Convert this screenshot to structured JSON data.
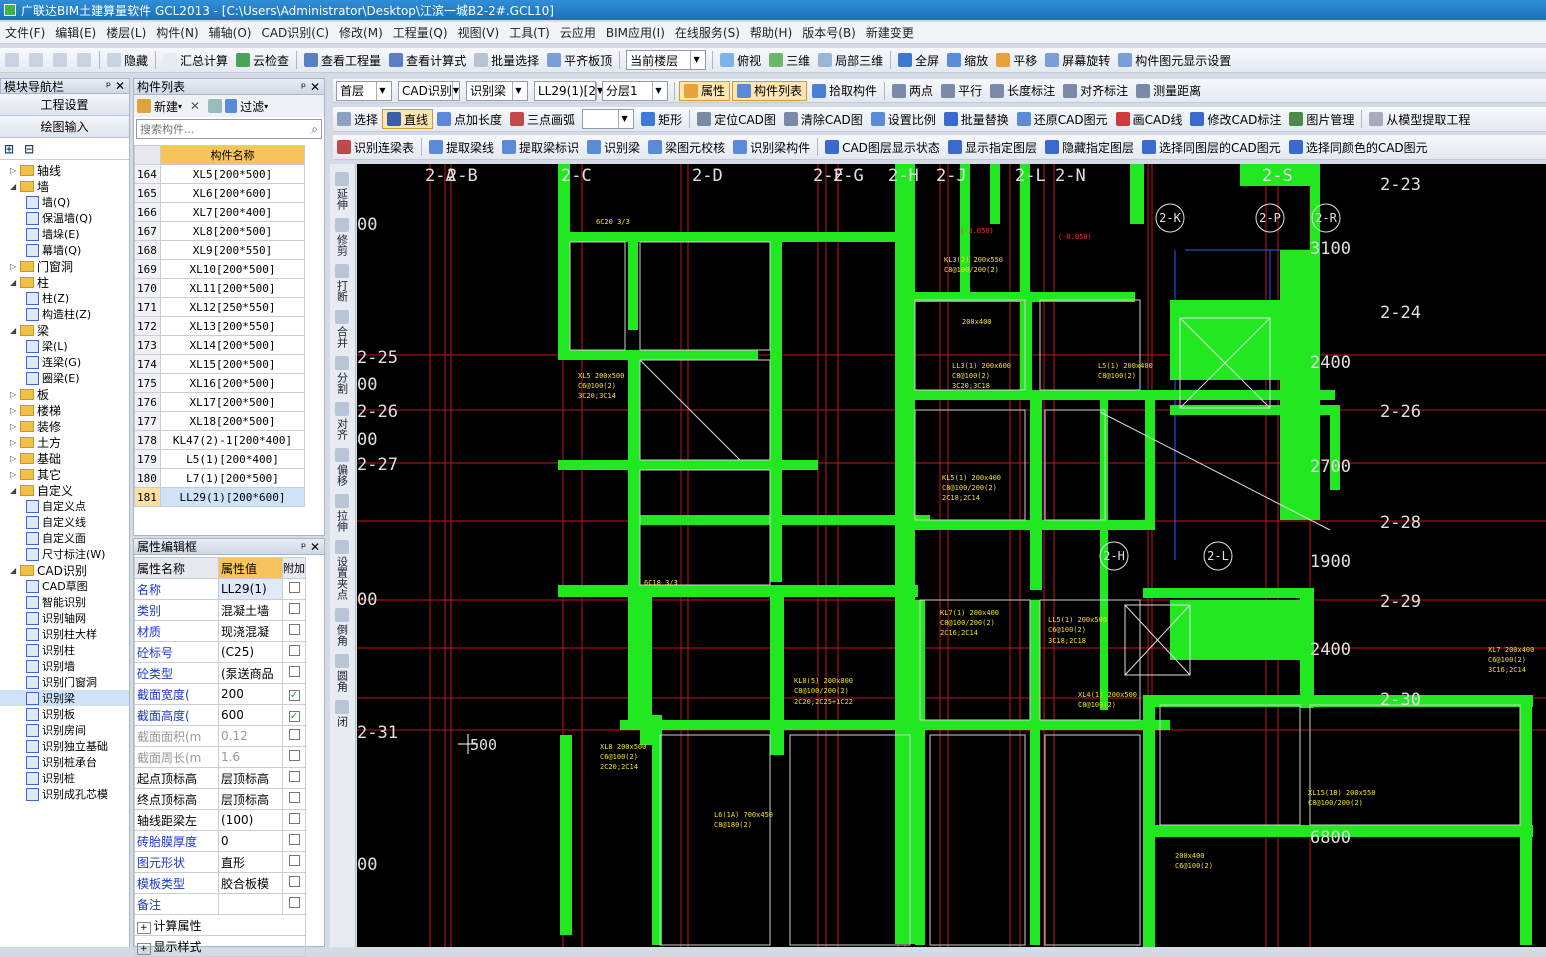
{
  "window": {
    "title": "广联达BIM土建算量软件 GCL2013 - [C:\\Users\\Administrator\\Desktop\\江滨一城B2-2#.GCL10]"
  },
  "menu": [
    "文件(F)",
    "编辑(E)",
    "楼层(L)",
    "构件(N)",
    "辅轴(O)",
    "CAD识别(C)",
    "修改(M)",
    "工程量(Q)",
    "视图(V)",
    "工具(T)",
    "云应用",
    "BIM应用(I)",
    "在线服务(S)",
    "帮助(H)",
    "版本号(B)",
    "新建变更"
  ],
  "toolbar1": {
    "items": [
      "隐藏",
      "汇总计算",
      "云检查",
      "查看工程量",
      "查看计算式",
      "批量选择",
      "平齐板顶"
    ],
    "floor_combo": "当前楼层",
    "view_items": [
      "俯视",
      "三维",
      "局部三维",
      "全屏",
      "缩放",
      "平移",
      "屏幕旋转",
      "构件图元显示设置"
    ]
  },
  "toolbar2": {
    "floor": "首层",
    "cad": "CAD识别",
    "type": "识别梁",
    "comp": "LL29(1)[2",
    "layer": "分层1",
    "items": [
      "属性",
      "构件列表",
      "拾取构件",
      "两点",
      "平行",
      "长度标注",
      "对齐标注",
      "测量距离"
    ]
  },
  "toolbar3": {
    "items": [
      "选择",
      "直线",
      "点加长度",
      "三点画弧",
      "矩形",
      "定位CAD图",
      "清除CAD图",
      "设置比例",
      "批量替换",
      "还原CAD图元",
      "画CAD线",
      "修改CAD标注",
      "图片管理",
      "从模型提取工程"
    ]
  },
  "toolbar4": {
    "items": [
      "识别连梁表",
      "提取梁线",
      "提取梁标识",
      "识别梁",
      "梁图元校核",
      "识别梁构件",
      "CAD图层显示状态",
      "显示指定图层",
      "隐藏指定图层",
      "选择同图层的CAD图元",
      "选择同颜色的CAD图元"
    ]
  },
  "nav": {
    "title": "模块导航栏",
    "btn1": "工程设置",
    "btn2": "绘图输入",
    "tree": [
      {
        "t": "轴线",
        "lv": 0,
        "f": 1
      },
      {
        "t": "墙",
        "lv": 0,
        "f": 1,
        "open": 1
      },
      {
        "t": "墙(Q)",
        "lv": 1
      },
      {
        "t": "保温墙(Q)",
        "lv": 1
      },
      {
        "t": "墙垛(E)",
        "lv": 1
      },
      {
        "t": "幕墙(Q)",
        "lv": 1
      },
      {
        "t": "门窗洞",
        "lv": 0,
        "f": 1
      },
      {
        "t": "柱",
        "lv": 0,
        "f": 1,
        "open": 1
      },
      {
        "t": "柱(Z)",
        "lv": 1
      },
      {
        "t": "构造柱(Z)",
        "lv": 1
      },
      {
        "t": "梁",
        "lv": 0,
        "f": 1,
        "open": 1
      },
      {
        "t": "梁(L)",
        "lv": 1
      },
      {
        "t": "连梁(G)",
        "lv": 1
      },
      {
        "t": "圈梁(E)",
        "lv": 1
      },
      {
        "t": "板",
        "lv": 0,
        "f": 1
      },
      {
        "t": "楼梯",
        "lv": 0,
        "f": 1
      },
      {
        "t": "装修",
        "lv": 0,
        "f": 1
      },
      {
        "t": "土方",
        "lv": 0,
        "f": 1
      },
      {
        "t": "基础",
        "lv": 0,
        "f": 1
      },
      {
        "t": "其它",
        "lv": 0,
        "f": 1
      },
      {
        "t": "自定义",
        "lv": 0,
        "f": 1,
        "open": 1
      },
      {
        "t": "自定义点",
        "lv": 1
      },
      {
        "t": "自定义线",
        "lv": 1
      },
      {
        "t": "自定义面",
        "lv": 1
      },
      {
        "t": "尺寸标注(W)",
        "lv": 1
      },
      {
        "t": "CAD识别",
        "lv": 0,
        "f": 1,
        "open": 1
      },
      {
        "t": "CAD草图",
        "lv": 1
      },
      {
        "t": "智能识别",
        "lv": 1
      },
      {
        "t": "识别轴网",
        "lv": 1
      },
      {
        "t": "识别柱大样",
        "lv": 1
      },
      {
        "t": "识别柱",
        "lv": 1
      },
      {
        "t": "识别墙",
        "lv": 1
      },
      {
        "t": "识别门窗洞",
        "lv": 1
      },
      {
        "t": "识别梁",
        "lv": 1,
        "sel": 1
      },
      {
        "t": "识别板",
        "lv": 1
      },
      {
        "t": "识别房间",
        "lv": 1
      },
      {
        "t": "识别独立基础",
        "lv": 1
      },
      {
        "t": "识别桩承台",
        "lv": 1
      },
      {
        "t": "识别桩",
        "lv": 1
      },
      {
        "t": "识别成孔芯模",
        "lv": 1
      }
    ]
  },
  "complist": {
    "title": "构件列表",
    "new_btn": "新建",
    "filter_btn": "过滤",
    "search_placeholder": "搜索构件...",
    "col": "构件名称",
    "rows": [
      [
        "164",
        "XL5[200*500]"
      ],
      [
        "165",
        "XL6[200*600]"
      ],
      [
        "166",
        "XL7[200*400]"
      ],
      [
        "167",
        "XL8[200*500]"
      ],
      [
        "168",
        "XL9[200*550]"
      ],
      [
        "169",
        "XL10[200*500]"
      ],
      [
        "170",
        "XL11[200*500]"
      ],
      [
        "171",
        "XL12[250*550]"
      ],
      [
        "172",
        "XL13[200*550]"
      ],
      [
        "173",
        "XL14[200*500]"
      ],
      [
        "174",
        "XL15[200*500]"
      ],
      [
        "175",
        "XL16[200*500]"
      ],
      [
        "176",
        "XL17[200*500]"
      ],
      [
        "177",
        "XL18[200*500]"
      ],
      [
        "178",
        "KL47(2)-1[200*400]"
      ],
      [
        "179",
        "L5(1)[200*400]"
      ],
      [
        "180",
        "L7(1)[200*500]"
      ],
      [
        "181",
        "LL29(1)[200*600]"
      ]
    ]
  },
  "props": {
    "title": "属性编辑框",
    "headers": [
      "属性名称",
      "属性值",
      "附加"
    ],
    "rows": [
      {
        "n": "名称",
        "v": "LL29(1)",
        "c": "",
        "blue": 1
      },
      {
        "n": "类别",
        "v": "混凝土墙",
        "c": "",
        "blue": 1
      },
      {
        "n": "材质",
        "v": "现浇混凝",
        "c": "",
        "blue": 1
      },
      {
        "n": "砼标号",
        "v": "(C25)",
        "c": "",
        "blue": 1
      },
      {
        "n": "砼类型",
        "v": "(泵送商品",
        "c": "",
        "blue": 1
      },
      {
        "n": "截面宽度(",
        "v": "200",
        "c": "✓",
        "blue": 1
      },
      {
        "n": "截面高度(",
        "v": "600",
        "c": "✓",
        "blue": 1
      },
      {
        "n": "截面面积(m",
        "v": "0.12",
        "c": "",
        "gray": 1
      },
      {
        "n": "截面周长(m",
        "v": "1.6",
        "c": "",
        "gray": 1
      },
      {
        "n": "起点顶标高",
        "v": "层顶标高",
        "c": ""
      },
      {
        "n": "终点顶标高",
        "v": "层顶标高",
        "c": ""
      },
      {
        "n": "轴线距梁左",
        "v": "(100)",
        "c": ""
      },
      {
        "n": "砖胎膜厚度",
        "v": "0",
        "c": "",
        "blue": 1
      },
      {
        "n": "图元形状",
        "v": "直形",
        "c": "",
        "blue": 1
      },
      {
        "n": "模板类型",
        "v": "胶合板模",
        "c": "",
        "blue": 1
      },
      {
        "n": "备注",
        "v": "",
        "c": "",
        "blue": 1
      },
      {
        "n": "计算属性",
        "v": "",
        "c": "",
        "group": 1
      },
      {
        "n": "显示样式",
        "v": "",
        "c": "",
        "group": 1
      }
    ]
  },
  "lefttools": [
    "延伸",
    "修剪",
    "打断",
    "合并",
    "分割",
    "对齐",
    "偏移",
    "拉伸",
    "设置夹点",
    "倒角",
    "圆角",
    "闭"
  ],
  "canvas": {
    "axis_top": [
      "2-A",
      "2-B",
      "2-C",
      "2-D",
      "2-F",
      "2-G",
      "2-H",
      "2-J",
      "2-L",
      "2-N",
      "2-S"
    ],
    "axis_right": [
      "2-23",
      "2-24",
      "2-26",
      "2-28",
      "2-29",
      "2-30"
    ],
    "axis_left": [
      "2-25",
      "2-26",
      "2-27",
      "2-31"
    ],
    "dims_right": [
      "3100",
      "2400",
      "2700",
      "1900",
      "2400",
      "6800"
    ],
    "dims_left": [
      "00",
      "00",
      "00",
      "00",
      "00",
      "00",
      "00",
      "00"
    ],
    "circles": [
      "2-K",
      "2-P",
      "2-R",
      "2-H",
      "2-L"
    ],
    "labels": [
      "KL3(2) 200x550",
      "C8@100/200(2)",
      "LL3(1) 200x600",
      "C8@100(2)",
      "3C20;3C18",
      "KL5(1) 200x400",
      "C8@100/200(2)",
      "2C18;2C14",
      "XL5 200x500",
      "C6@100(2)",
      "3C20;3C14",
      "KL7(1) 200x400",
      "C8@100/200(2)",
      "2C16;2C14",
      "LL5(1) 200x500",
      "C6@100(2)",
      "3C18;2C18",
      "XL8 200x500",
      "C6@100(2)",
      "2C20;2C14",
      "L6(1A) 700x450",
      "C8@180(2)",
      "KL8(5) 200x800",
      "C8@100/200(2)",
      "2C20;2C25+1C22",
      "XL4(1) 200x500",
      "C8@100(2)",
      "XL15(1B) 200x550",
      "C8@100/200(2)",
      "XL7 200x400",
      "C6@100(2)",
      "3C16;2C14",
      "6C20 3/3",
      "6C18 3/3",
      "200x400",
      "(-3.050)",
      "(-0.050)",
      "L5(1) 200x400",
      "C8@100(2)",
      "200x400",
      "C6@100(2)"
    ],
    "cursor_label": "500"
  }
}
